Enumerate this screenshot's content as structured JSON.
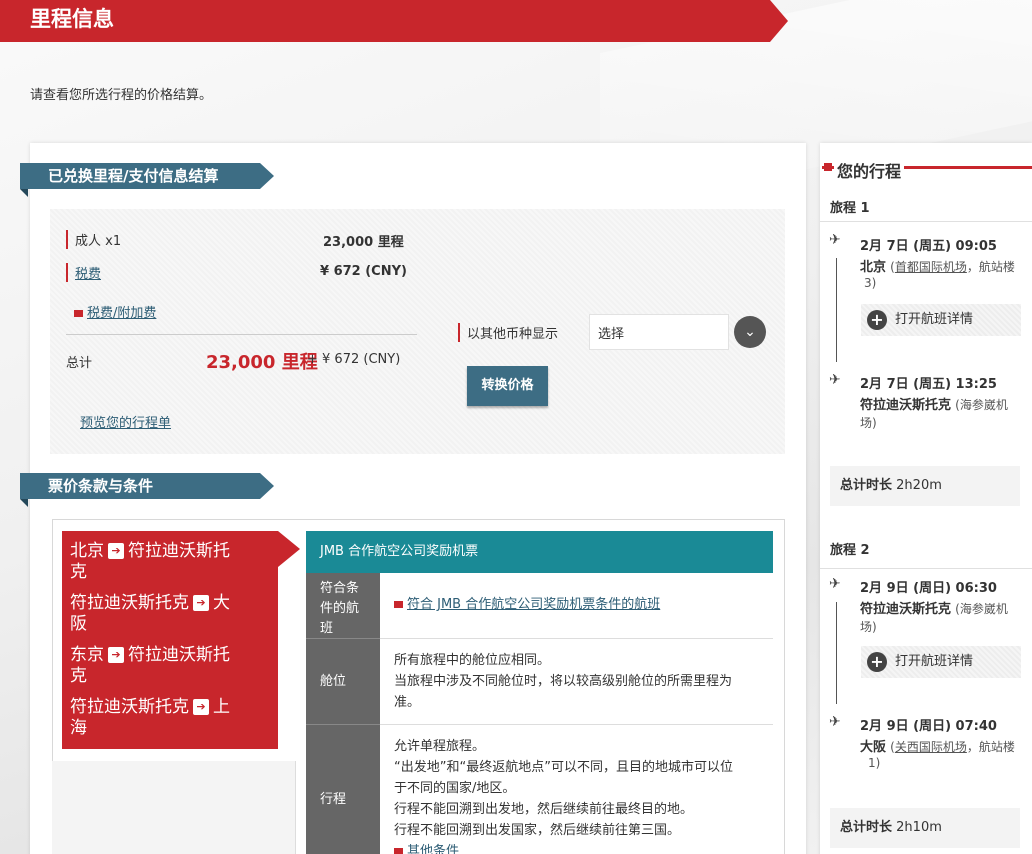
{
  "header": {
    "title": "里程信息"
  },
  "intro": "请查看您所选行程的价格结算。",
  "payment": {
    "section_title": "已兑换里程/支付信息结算",
    "adult_label": "成人 x1",
    "adult_value": "23,000 里程",
    "fee_label": "税费",
    "fee_value": "¥ 672 (CNY)",
    "surcharge_link": "税费/附加费",
    "total_label": "总计",
    "total_miles": "23,000 里程",
    "total_extra": "+ ¥ 672 (CNY)",
    "preview_link": "预览您的行程单",
    "currency_label": "以其他币种显示",
    "currency_select": "选择",
    "convert_button": "转换价格"
  },
  "fare": {
    "section_title": "票价条款与条件",
    "routes": [
      {
        "from": "北京",
        "to": "符拉迪沃斯托",
        "to2": "克"
      },
      {
        "from": "符拉迪沃斯托克",
        "to": "大",
        "to2": "阪"
      },
      {
        "from": "东京",
        "to": "符拉迪沃斯托",
        "to2": "克"
      },
      {
        "from": "符拉迪沃斯托克",
        "to": "上",
        "to2": "海"
      }
    ],
    "arrow": "➔",
    "title": "JMB 合作航空公司奖励机票",
    "rows": [
      {
        "head1": "符合条",
        "head2": "件的航",
        "head3": "班",
        "link": "符合 JMB 合作航空公司奖励机票条件的航班"
      },
      {
        "head": "舱位",
        "l1": "所有旅程中的舱位应相同。",
        "l2": "当旅程中涉及不同舱位时，将以较高级别舱位的所需里程为",
        "l3": "准。"
      },
      {
        "head": "行程",
        "l1": "允许单程旅程。",
        "l2": "“出发地”和“最终返航地点”可以不同，且目的地城市可以位",
        "l3": "于不同的国家/地区。",
        "l4": "行程不能回溯到出发地，然后继续前往最终目的地。",
        "l5": "行程不能回溯到出发国家，然后继续前往第三国。",
        "link": "其他条件"
      }
    ]
  },
  "itinerary": {
    "title": "您的行程",
    "legs": [
      {
        "label": "旅程 1",
        "dep_time": "2月 7日 (周五)   09:05",
        "dep_city": "北京",
        "dep_airport": "首都国际机场",
        "dep_term": "，航站楼",
        "dep_term2": "3)",
        "details": "打开航班详情",
        "arr_time": "2月 7日 (周五)   13:25",
        "arr_city": "符拉迪沃斯托克",
        "arr_airport": "(海参崴机",
        "arr_airport2": "场)",
        "total_label": "总计时长",
        "total": "2h20m"
      },
      {
        "label": "旅程 2",
        "dep_time": "2月 9日 (周日)   06:30",
        "dep_city": "符拉迪沃斯托克",
        "dep_airport": "(海参崴机",
        "dep_airport2": "场)",
        "details": "打开航班详情",
        "arr_time": "2月 9日 (周日)   07:40",
        "arr_city": "大阪",
        "arr_airport": "关西国际机场",
        "arr_term": "，航站楼",
        "arr_term2": "1)",
        "total_label": "总计时长",
        "total": "2h10m"
      }
    ]
  },
  "colors": {
    "red": "#c8262c",
    "teal": "#1a8a96",
    "steel": "#3d6d84"
  }
}
